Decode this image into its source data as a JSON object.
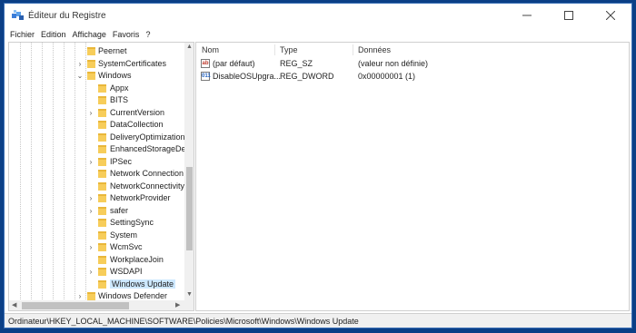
{
  "window": {
    "title": "Éditeur du Registre",
    "minimize_glyph": "—",
    "maximize_glyph": "☐",
    "close_glyph": "✕"
  },
  "menu": {
    "items": [
      "Fichier",
      "Edition",
      "Affichage",
      "Favoris",
      "?"
    ]
  },
  "tree": {
    "items": [
      {
        "label": "Peernet",
        "level": 1,
        "expand": "none",
        "selected": false
      },
      {
        "label": "SystemCertificates",
        "level": 1,
        "expand": "collapsed",
        "selected": false
      },
      {
        "label": "Windows",
        "level": 1,
        "expand": "expanded",
        "selected": false
      },
      {
        "label": "Appx",
        "level": 2,
        "expand": "none",
        "selected": false
      },
      {
        "label": "BITS",
        "level": 2,
        "expand": "none",
        "selected": false
      },
      {
        "label": "CurrentVersion",
        "level": 2,
        "expand": "collapsed",
        "selected": false
      },
      {
        "label": "DataCollection",
        "level": 2,
        "expand": "none",
        "selected": false
      },
      {
        "label": "DeliveryOptimization",
        "level": 2,
        "expand": "none",
        "selected": false
      },
      {
        "label": "EnhancedStorageDev",
        "level": 2,
        "expand": "none",
        "selected": false
      },
      {
        "label": "IPSec",
        "level": 2,
        "expand": "collapsed",
        "selected": false
      },
      {
        "label": "Network Connection",
        "level": 2,
        "expand": "none",
        "selected": false
      },
      {
        "label": "NetworkConnectivity",
        "level": 2,
        "expand": "none",
        "selected": false
      },
      {
        "label": "NetworkProvider",
        "level": 2,
        "expand": "collapsed",
        "selected": false
      },
      {
        "label": "safer",
        "level": 2,
        "expand": "collapsed",
        "selected": false
      },
      {
        "label": "SettingSync",
        "level": 2,
        "expand": "none",
        "selected": false
      },
      {
        "label": "System",
        "level": 2,
        "expand": "none",
        "selected": false
      },
      {
        "label": "WcmSvc",
        "level": 2,
        "expand": "collapsed",
        "selected": false
      },
      {
        "label": "WorkplaceJoin",
        "level": 2,
        "expand": "none",
        "selected": false
      },
      {
        "label": "WSDAPI",
        "level": 2,
        "expand": "collapsed",
        "selected": false
      },
      {
        "label": "Windows Update",
        "level": 2,
        "expand": "none",
        "selected": true
      },
      {
        "label": "Windows Defender",
        "level": 1,
        "expand": "collapsed",
        "selected": false
      }
    ]
  },
  "list": {
    "headers": {
      "name": "Nom",
      "type": "Type",
      "data": "Données"
    },
    "rows": [
      {
        "icon": "string-value-icon",
        "icon_text": "ab",
        "name": "(par défaut)",
        "type": "REG_SZ",
        "data": "(valeur non définie)"
      },
      {
        "icon": "binary-value-icon",
        "icon_text": "011",
        "name": "DisableOSUpgra...",
        "type": "REG_DWORD",
        "data": "0x00000001 (1)"
      }
    ]
  },
  "status": {
    "path": "Ordinateur\\HKEY_LOCAL_MACHINE\\SOFTWARE\\Policies\\Microsoft\\Windows\\Windows Update"
  },
  "colors": {
    "desktop": "#0b3f86",
    "folder": "#f7cd5a",
    "selection": "#cde8ff"
  }
}
